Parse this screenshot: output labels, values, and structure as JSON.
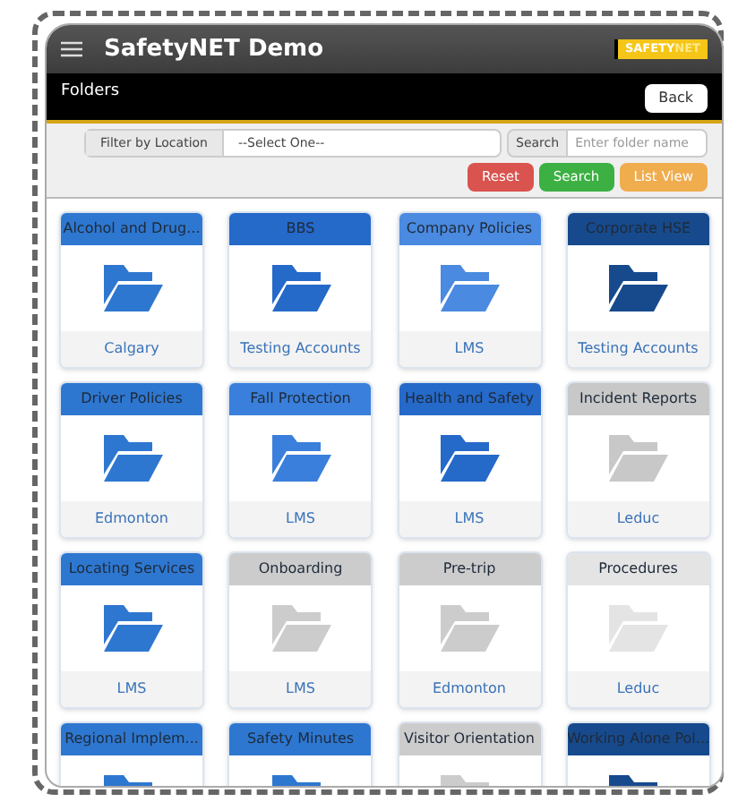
{
  "header": {
    "title": "SafetyNET Demo",
    "logo": {
      "strong": "SAFETY",
      "light": "NET"
    }
  },
  "page_bar": {
    "title": "Folders",
    "back_button": "Back"
  },
  "filter": {
    "location_label": "Filter by Location",
    "location_value": "--Select One--",
    "search_label": "Search",
    "search_placeholder": "Enter folder name"
  },
  "buttons": [
    {
      "label": "Reset",
      "kind": "danger"
    },
    {
      "label": "Search",
      "kind": "success"
    },
    {
      "label": "List View",
      "kind": "warning"
    }
  ],
  "folders": [
    {
      "name": "Alcohol and Drug...",
      "location": "Calgary",
      "color": "#2e77d0"
    },
    {
      "name": "BBS",
      "location": "Testing Accounts",
      "color": "#2569c9"
    },
    {
      "name": "Company Policies",
      "location": "LMS",
      "color": "#4a8ae0"
    },
    {
      "name": "Corporate HSE",
      "location": "Testing Accounts",
      "color": "#174a8c"
    },
    {
      "name": "Driver Policies",
      "location": "Edmonton",
      "color": "#2e77d0"
    },
    {
      "name": "Fall Protection",
      "location": "LMS",
      "color": "#3a7fdb"
    },
    {
      "name": "Health and Safety",
      "location": "LMS",
      "color": "#2569c9"
    },
    {
      "name": "Incident Reports",
      "location": "Leduc",
      "color": "#c8c8c8"
    },
    {
      "name": "Locating Services",
      "location": "LMS",
      "color": "#2e77d0"
    },
    {
      "name": "Onboarding",
      "location": "LMS",
      "color": "#cccccc"
    },
    {
      "name": "Pre-trip",
      "location": "Edmonton",
      "color": "#cccccc"
    },
    {
      "name": "Procedures",
      "location": "Leduc",
      "color": "#e4e4e4"
    },
    {
      "name": "Regional Implem...",
      "color": "#2e77d0"
    },
    {
      "name": "Safety Minutes",
      "color": "#2e77d0"
    },
    {
      "name": "Visitor Orientation",
      "color": "#cccccc"
    },
    {
      "name": "Working Alone Pol...",
      "color": "#174a8c"
    }
  ]
}
